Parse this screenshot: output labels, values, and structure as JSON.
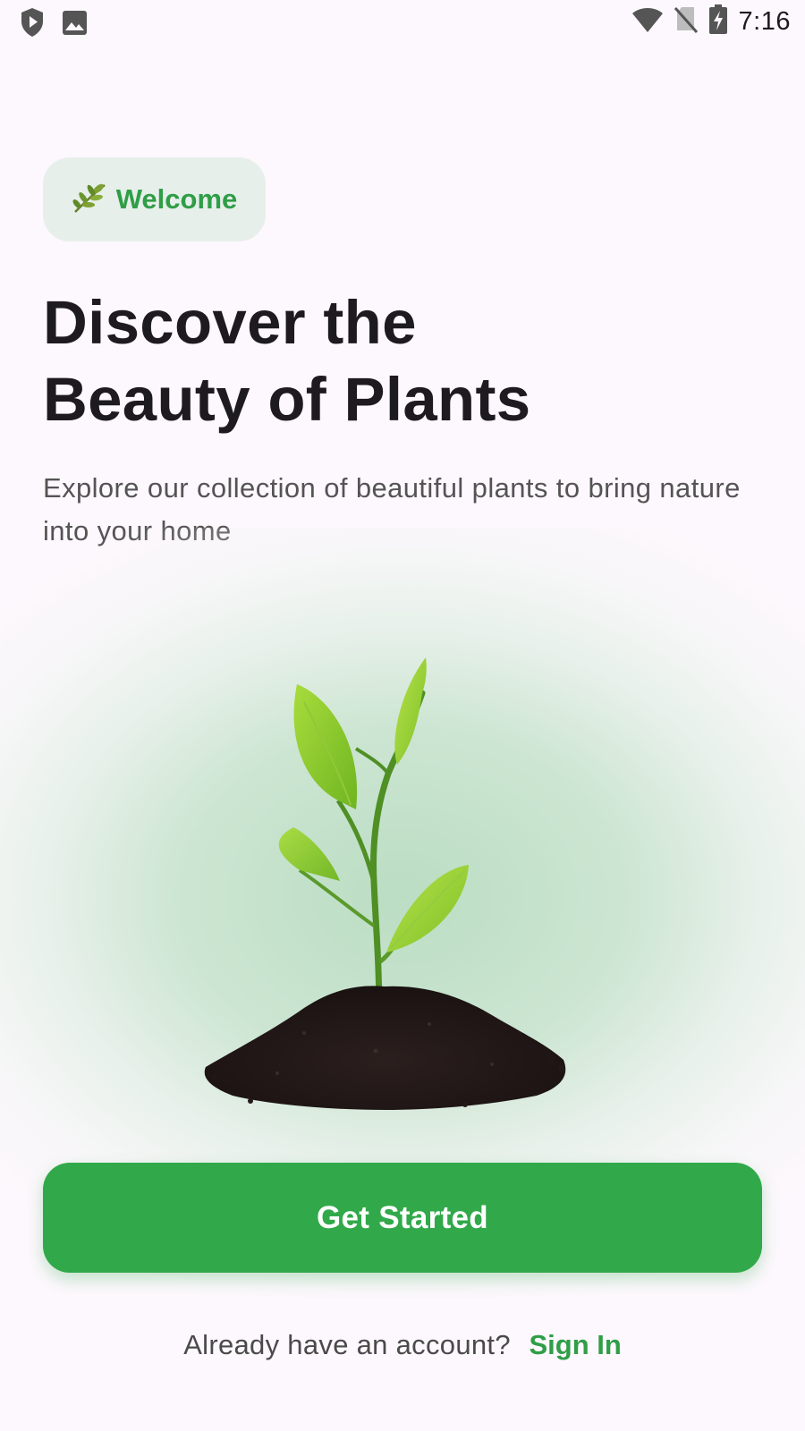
{
  "status_bar": {
    "time": "7:16",
    "icons": [
      "shield-play-icon",
      "image-icon",
      "wifi-icon",
      "no-sim-icon",
      "battery-charging-icon"
    ]
  },
  "welcome_chip": {
    "icon": "herb-icon",
    "emoji": "🌿",
    "label": "Welcome"
  },
  "headline": {
    "line1": "Discover the",
    "line2": "Beauty of Plants"
  },
  "subtitle": "Explore our collection of beautiful plants to bring nature into your home",
  "hero": {
    "image": "plant-sprout-in-soil"
  },
  "cta": {
    "label": "Get Started"
  },
  "signin": {
    "prompt": "Already have an account?",
    "link": "Sign In"
  },
  "colors": {
    "accent": "#31a94a",
    "accent_text": "#2f9e47",
    "chip_bg": "#e7efea",
    "background": "#fdf8fd",
    "headline": "#1d1b20"
  }
}
